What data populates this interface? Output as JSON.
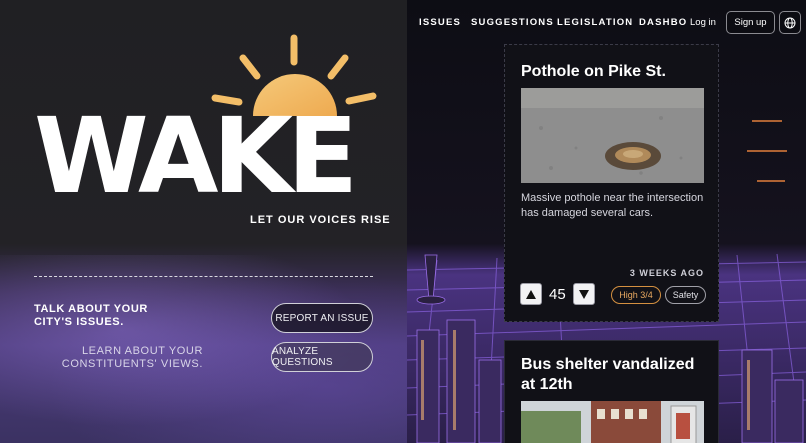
{
  "brand": {
    "name": "WAKE",
    "tagline": "LET OUR VOICES RISE",
    "colors": {
      "sun_start": "#f0b455",
      "sun_end": "#f5c97a",
      "accent_purple": "#7a5ad8"
    }
  },
  "hero": {
    "talk_text": "TALK ABOUT YOUR CITY'S ISSUES.",
    "learn_text": "LEARN ABOUT YOUR CONSTITUENTS' VIEWS.",
    "report_button": "REPORT AN ISSUE",
    "analyze_button": "ANALYZE QUESTIONS"
  },
  "nav": {
    "items": [
      {
        "label": "ISSUES"
      },
      {
        "label": "SUGGESTIONS"
      },
      {
        "label": "LEGISLATION"
      },
      {
        "label": "DASHBO"
      }
    ],
    "login": "Log in",
    "signup": "Sign up",
    "globe_icon": "globe-icon"
  },
  "issues": [
    {
      "title": "Pothole on Pike St.",
      "description": "Massive pothole near the intersection has damaged several cars.",
      "time_ago": "3 WEEKS AGO",
      "votes": "45",
      "priority": "High 3/4",
      "category": "Safety",
      "priority_color": "#d49040"
    },
    {
      "title": "Bus shelter vandalized at 12th"
    }
  ]
}
